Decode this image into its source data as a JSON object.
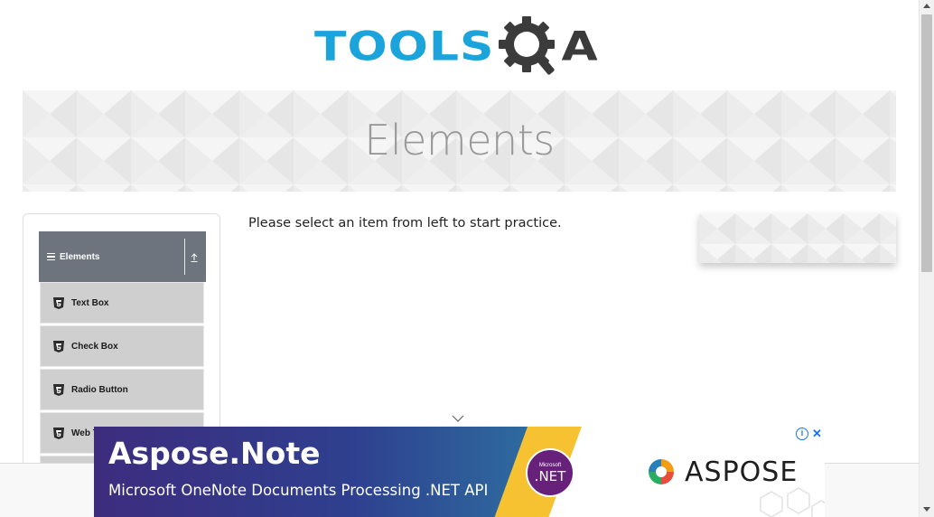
{
  "header": {
    "logo_text_tools": "TOOLS",
    "logo_text_a": "A",
    "logo_colors": {
      "tools": "#1aa4db",
      "qa": "#3b3b3b"
    }
  },
  "banner": {
    "title": "Elements"
  },
  "sidebar": {
    "group": {
      "label": "Elements",
      "icon": "hamburger-icon",
      "toggle_icon": "collapse-up-icon"
    },
    "items": [
      {
        "label": "Text Box",
        "icon": "html5-icon"
      },
      {
        "label": "Check Box",
        "icon": "html5-icon"
      },
      {
        "label": "Radio Button",
        "icon": "html5-icon"
      },
      {
        "label": "Web Tables",
        "icon": "html5-icon"
      }
    ],
    "colors": {
      "group_bg": "#6d747e",
      "item_bg": "#cfcfcf"
    }
  },
  "main": {
    "intro_text": "Please select an item from left to start practice."
  },
  "ad": {
    "title": "Aspose.Note",
    "subtitle": "Microsoft OneNote Documents Processing .NET API",
    "badge_small": "Microsoft",
    "badge_big": ".NET",
    "brand": "ASPOSE",
    "info_icon": "info-icon",
    "close_icon": "close-icon",
    "colors": {
      "gradient_start": "#3d2c7e",
      "accent": "#f7c232",
      "badge": "#68217a"
    }
  }
}
